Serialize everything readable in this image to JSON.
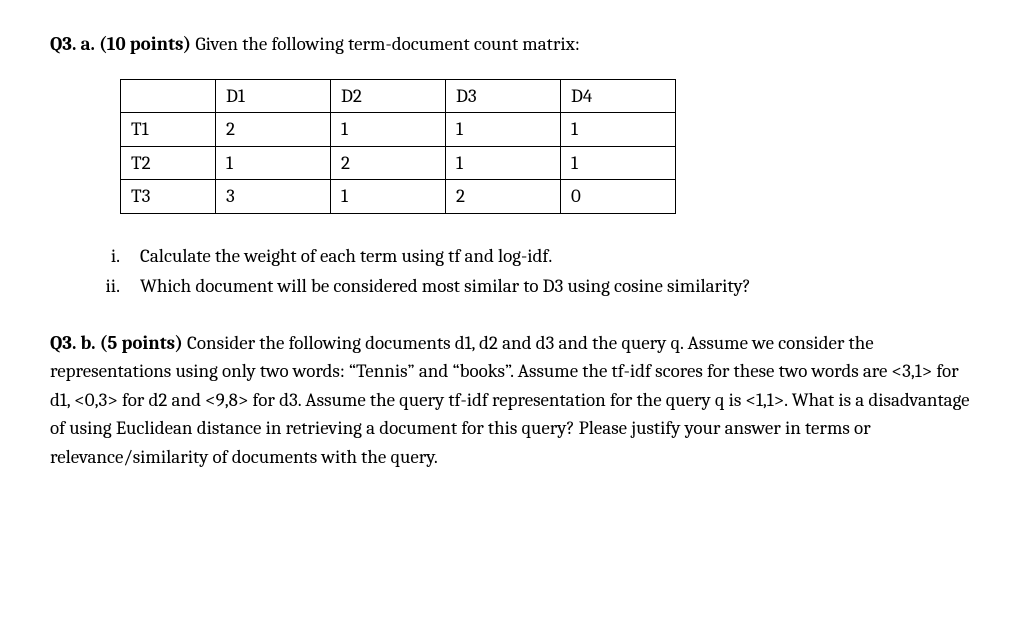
{
  "q3a": {
    "label": "Q3. a. (10 points)",
    "intro": " Given the following term-document count matrix:",
    "table": {
      "headers": [
        "",
        "D1",
        "D2",
        "D3",
        "D4"
      ],
      "rows": [
        {
          "label": "T1",
          "cells": [
            "2",
            "1",
            "1",
            "1"
          ]
        },
        {
          "label": "T2",
          "cells": [
            "1",
            "2",
            "1",
            "1"
          ]
        },
        {
          "label": "T3",
          "cells": [
            "3",
            "1",
            "2",
            "0"
          ]
        }
      ]
    },
    "list": {
      "items": [
        {
          "marker": "i.",
          "text": "Calculate the weight of each term using tf and log-idf."
        },
        {
          "marker": "ii.",
          "text": "Which document will be considered most similar to D3 using cosine similarity?"
        }
      ]
    }
  },
  "q3b": {
    "label": "Q3. b. (5 points)",
    "text": " Consider the following documents d1, d2 and d3 and the query q. Assume we consider the representations using only two words: “Tennis” and “books”. Assume the tf-idf scores for these two words are <3,1> for d1, <0,3> for d2 and <9,8> for d3. Assume the query tf-idf representation for the query q is <1,1>. What is a disadvantage of using Euclidean distance in retrieving a document for this query? Please justify your answer in terms or relevance/similarity of documents with the query."
  }
}
